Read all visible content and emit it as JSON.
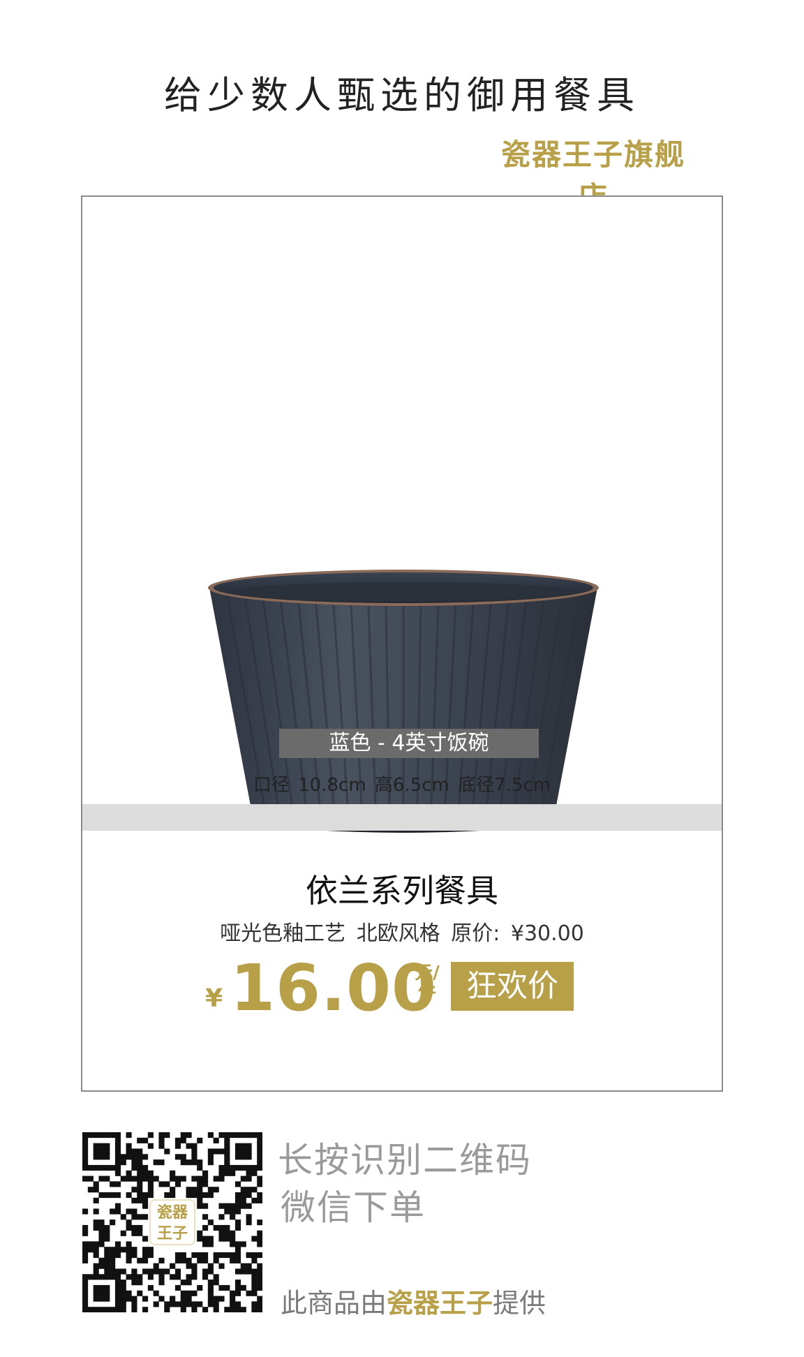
{
  "header": {
    "headline": "给少数人甄选的御用餐具",
    "store_name": "瓷器王子旗舰店"
  },
  "product": {
    "variant": "蓝色 - 4英寸饭碗",
    "dimensions": "口径 10.8cm  高6.5cm  底径7.5cm",
    "title": "依兰系列餐具",
    "description": "哑光色釉工艺  北欧风格  原价: ¥30.00",
    "price": {
      "currency": "¥",
      "amount": "16.00",
      "unit": "元/件",
      "promo_label": "狂欢价"
    },
    "image_icon": "bowl-image"
  },
  "footer": {
    "scan_line1": "长按识别二维码",
    "scan_line2": "微信下单",
    "provided_prefix": "此商品由",
    "provided_brand": "瓷器王子",
    "provided_suffix": "提供",
    "qr_logo_line1": "瓷器",
    "qr_logo_line2": "王子"
  },
  "colors": {
    "accent_gold": "#b8a048",
    "label_gray": "#6b6b6b",
    "band_gray": "#dcdcdc"
  }
}
